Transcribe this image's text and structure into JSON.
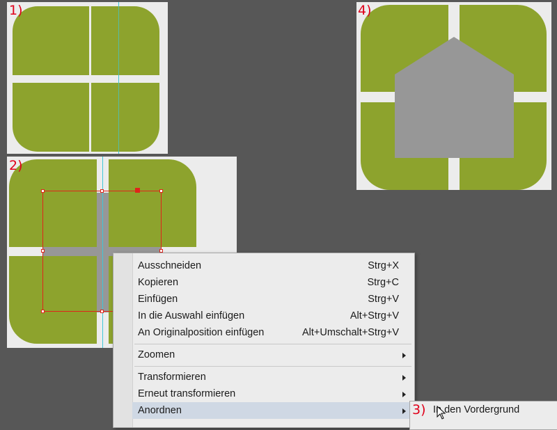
{
  "steps": {
    "step1": "1)",
    "step2": "2)",
    "step3": "3)",
    "step4": "4)"
  },
  "colors": {
    "canvas": "#575757",
    "artboard": "#ececec",
    "shape_green": "#8da32d",
    "shape_gray": "#979797",
    "selection": "#e0241a",
    "guide": "#3fc6d8",
    "step_label": "#e0001a"
  },
  "context_menu": {
    "items": [
      {
        "label": "Ausschneiden",
        "shortcut": "Strg+X"
      },
      {
        "label": "Kopieren",
        "shortcut": "Strg+C"
      },
      {
        "label": "Einfügen",
        "shortcut": "Strg+V"
      },
      {
        "label": "In die Auswahl einfügen",
        "shortcut": "Alt+Strg+V"
      },
      {
        "label": "An Originalposition einfügen",
        "shortcut": "Alt+Umschalt+Strg+V"
      },
      {
        "label": "Zoomen",
        "submenu": true
      },
      {
        "label": "Transformieren",
        "submenu": true
      },
      {
        "label": "Erneut transformieren",
        "submenu": true
      },
      {
        "label": "Anordnen",
        "submenu": true
      }
    ]
  },
  "submenu": {
    "item": "In den Vordergrund"
  },
  "icons": {
    "cursor": "mouse-pointer-icon",
    "submenu_arrow": "chevron-right-icon"
  }
}
